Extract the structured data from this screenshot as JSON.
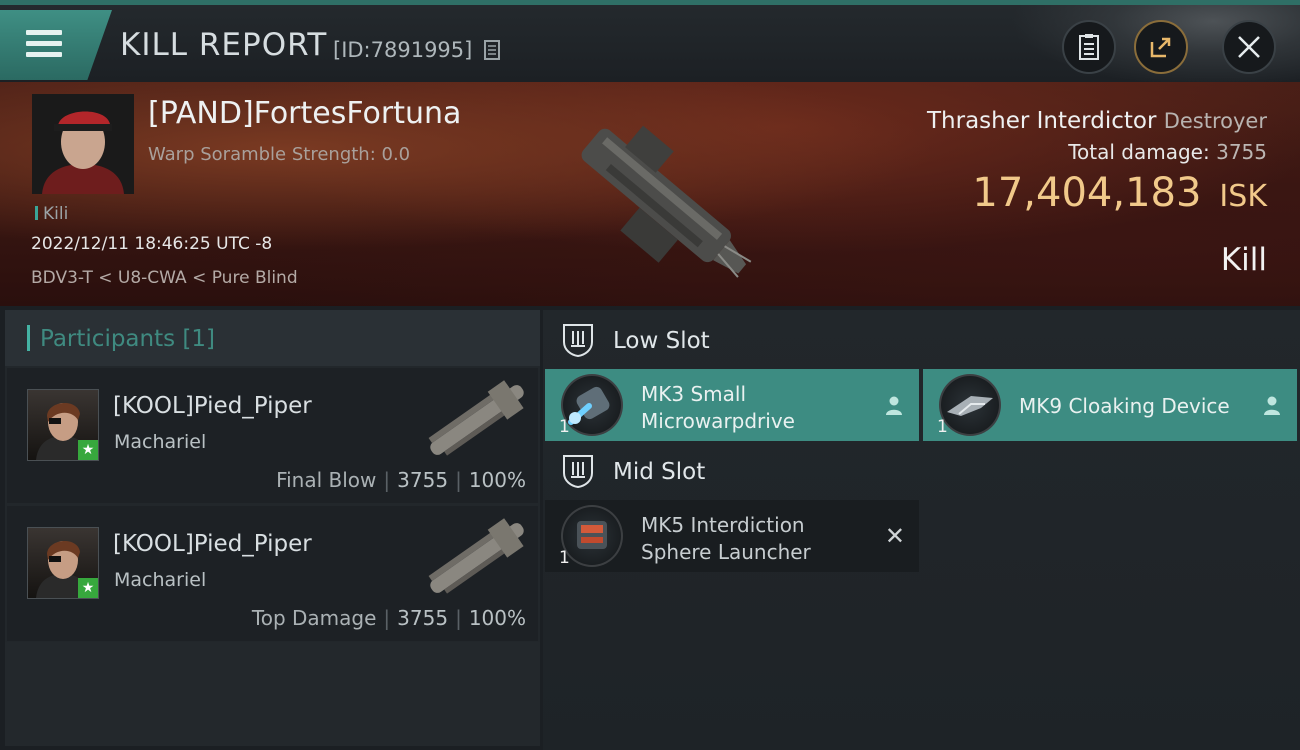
{
  "header": {
    "title": "KILL REPORT",
    "report_id": "[ID:7891995]",
    "icons": [
      "menu-icon",
      "copy-icon",
      "clipboard-icon",
      "share-icon",
      "close-icon"
    ]
  },
  "victim": {
    "name": "[PAND]FortesFortuna",
    "warp_scramble": "Warp Soramble Strength: 0.0",
    "tag": "Kili",
    "datetime": "2022/12/11 18:46:25 UTC -8",
    "location": "BDV3-T < U8-CWA < Pure Blind",
    "ship_name": "Thrasher Interdictor",
    "ship_class": "Destroyer",
    "total_damage_label": "Total damage:",
    "total_damage": "3755",
    "isk_value": "17,404,183",
    "isk_unit": "ISK",
    "verdict": "Kill"
  },
  "participants": {
    "label": "Participants",
    "count": "[1]",
    "rows": [
      {
        "name": "[KOOL]Pied_Piper",
        "ship": "Machariel",
        "role": "Final Blow",
        "damage": "3755",
        "percent": "100%"
      },
      {
        "name": "[KOOL]Pied_Piper",
        "ship": "Machariel",
        "role": "Top Damage",
        "damage": "3755",
        "percent": "100%"
      }
    ]
  },
  "slots": {
    "low": {
      "label": "Low Slot",
      "modules": [
        {
          "qty": "1",
          "name_line1": "MK3 Small",
          "name_line2": "Microwarpdrive"
        },
        {
          "qty": "1",
          "name": "MK9 Cloaking Device"
        }
      ]
    },
    "mid": {
      "label": "Mid Slot",
      "modules": [
        {
          "qty": "1",
          "name_line1": "MK5 Interdiction",
          "name_line2": "Sphere Launcher"
        }
      ]
    }
  },
  "colors": {
    "accent": "#3d8c82",
    "isk": "#f1c98a",
    "participants_label": "#3f8a80"
  }
}
